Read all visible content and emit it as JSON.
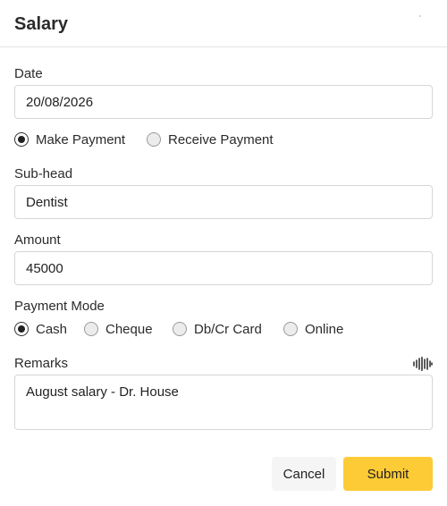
{
  "header": {
    "title": "Salary"
  },
  "form": {
    "date": {
      "label": "Date",
      "value": "20/08/2026"
    },
    "payment_type": {
      "options": [
        {
          "label": "Make Payment",
          "checked": true
        },
        {
          "label": "Receive Payment",
          "checked": false
        }
      ]
    },
    "subhead": {
      "label": "Sub-head",
      "value": "Dentist"
    },
    "amount": {
      "label": "Amount",
      "value": "45000"
    },
    "payment_mode": {
      "label": "Payment Mode",
      "options": [
        {
          "label": "Cash",
          "checked": true
        },
        {
          "label": "Cheque",
          "checked": false
        },
        {
          "label": "Db/Cr Card",
          "checked": false
        },
        {
          "label": "Online",
          "checked": false
        }
      ]
    },
    "remarks": {
      "label": "Remarks",
      "value": "August salary - Dr. House",
      "voice_icon": "waveform-icon"
    }
  },
  "actions": {
    "cancel_label": "Cancel",
    "submit_label": "Submit",
    "submit_color": "#fdcb35"
  }
}
